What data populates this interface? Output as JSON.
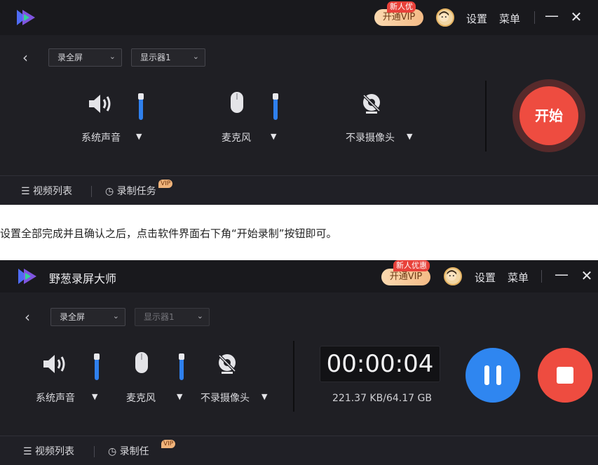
{
  "screenshot1": {
    "titlebar": {
      "vip_button": "开通VIP",
      "vip_tag": "新人优",
      "settings": "设置",
      "menu": "菜单"
    },
    "toolbar": {
      "mode_select": "录全屏",
      "display_select": "显示器1"
    },
    "controls": {
      "system_audio_label": "系统声音",
      "system_audio_level": 0.85,
      "mic_label": "麦克风",
      "mic_level": 0.85,
      "camera_label": "不录摄像头"
    },
    "start_button": "开始",
    "bottom": {
      "video_list": "视频列表",
      "record_task": "录制任务",
      "vip_badge": "VIP"
    }
  },
  "caption": "设置全部完成并且确认之后，点击软件界面右下角“开始录制”按钮即可。",
  "screenshot2": {
    "titlebar": {
      "app_title": "野葱录屏大师",
      "vip_button": "开通VIP",
      "vip_tag": "新人优惠",
      "settings": "设置",
      "menu": "菜单"
    },
    "toolbar": {
      "mode_select": "录全屏",
      "display_select": "显示器1"
    },
    "controls": {
      "system_audio_label": "系统声音",
      "system_audio_level": 0.85,
      "mic_label": "麦克风",
      "mic_level": 0.85,
      "camera_label": "不录摄像头"
    },
    "timer": "00:00:04",
    "storage": "221.37 KB/64.17 GB",
    "bottom": {
      "video_list": "视频列表",
      "record_task": "录制任",
      "vip_badge": "VIP"
    }
  },
  "colors": {
    "accent_blue": "#2f86f0",
    "record_red": "#ee4c40",
    "panel_bg": "#1f1f24"
  }
}
